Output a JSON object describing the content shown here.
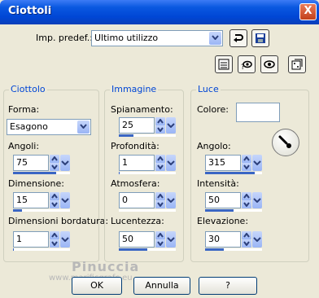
{
  "window": {
    "title": "Ciottoli",
    "close_glyph": "X"
  },
  "preset": {
    "label": "Imp. predef.:",
    "value": "Ultimo utilizzo",
    "icons": [
      "reset-icon",
      "save-icon"
    ]
  },
  "toolbar_icons": [
    "preview-list-icon",
    "randomize-eye-icon",
    "eye-icon",
    "dice-icon"
  ],
  "groups": {
    "ciottolo": {
      "title": "Ciottolo",
      "forma_label": "Forma:",
      "forma_value": "Esagono",
      "angoli_label": "Angoli:",
      "angoli_value": "75",
      "angoli_level": 0.75,
      "dimensione_label": "Dimensione:",
      "dimensione_value": "15",
      "dimensione_level": 0.15,
      "bordatura_label": "Dimensioni bordatura:",
      "bordatura_value": "1",
      "bordatura_level": 0.01
    },
    "immagine": {
      "title": "Immagine",
      "spianamento_label": "Spianamento:",
      "spianamento_value": "25",
      "spianamento_level": 0.25,
      "profondita_label": "Profondità:",
      "profondita_value": "1",
      "profondita_level": 0.01,
      "atmosfera_label": "Atmosfera:",
      "atmosfera_value": "0",
      "atmosfera_level": 0.0,
      "lucentezza_label": "Lucentezza:",
      "lucentezza_value": "50",
      "lucentezza_level": 0.5
    },
    "luce": {
      "title": "Luce",
      "colore_label": "Colore:",
      "colore_value": "#ffffff",
      "angolo_label": "Angolo:",
      "angolo_value": "315",
      "angolo_level": 0.875,
      "intensita_label": "Intensità:",
      "intensita_value": "50",
      "intensita_level": 0.5,
      "elevazione_label": "Elevazione:",
      "elevazione_value": "30",
      "elevazione_level": 0.33
    }
  },
  "buttons": {
    "ok": "OK",
    "annulla": "Annulla",
    "help": "?"
  },
  "watermark": {
    "name": "Pinuccia",
    "url": "www.marificgrafc.eu"
  },
  "colors": {
    "accent": "#0046d5",
    "group_title": "#0046d5",
    "bar": "#3a66c4"
  }
}
